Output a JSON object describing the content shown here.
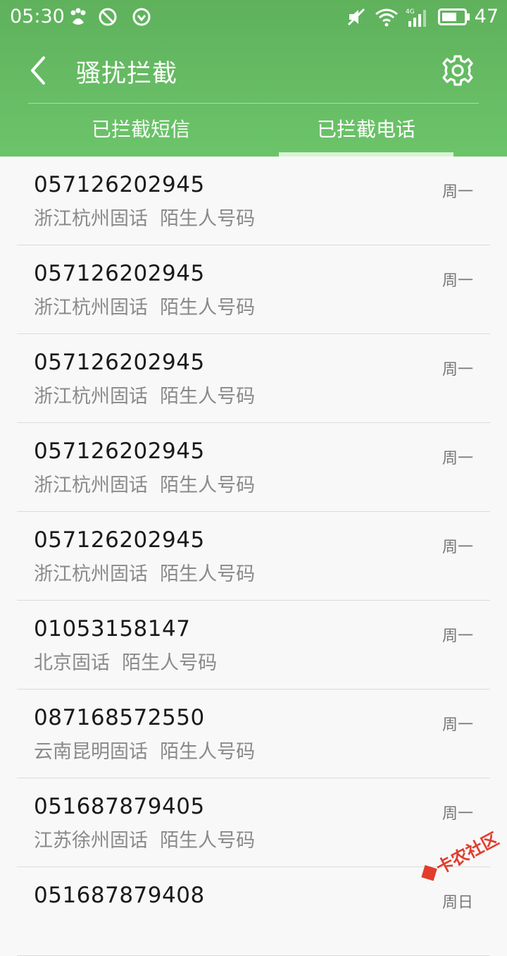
{
  "status_bar": {
    "time": "05:30",
    "battery": "47",
    "icons": [
      "baidu-paw-icon",
      "no-disturb-icon",
      "download-icon",
      "mute-icon",
      "wifi-icon",
      "signal-4g-icon",
      "battery-icon"
    ]
  },
  "toolbar": {
    "title": "骚扰拦截",
    "back_icon": "chevron-left-icon",
    "settings_icon": "gear-icon"
  },
  "tabs": [
    {
      "label": "已拦截短信",
      "active": false
    },
    {
      "label": "已拦截电话",
      "active": true
    }
  ],
  "calls": [
    {
      "number": "057126202945",
      "desc": "浙江杭州固话  陌生人号码",
      "day": "周一"
    },
    {
      "number": "057126202945",
      "desc": "浙江杭州固话  陌生人号码",
      "day": "周一"
    },
    {
      "number": "057126202945",
      "desc": "浙江杭州固话  陌生人号码",
      "day": "周一"
    },
    {
      "number": "057126202945",
      "desc": "浙江杭州固话  陌生人号码",
      "day": "周一"
    },
    {
      "number": "057126202945",
      "desc": "浙江杭州固话  陌生人号码",
      "day": "周一"
    },
    {
      "number": "01053158147",
      "desc": "北京固话  陌生人号码",
      "day": "周一"
    },
    {
      "number": "087168572550",
      "desc": "云南昆明固话  陌生人号码",
      "day": "周一"
    },
    {
      "number": "051687879405",
      "desc": "江苏徐州固话  陌生人号码",
      "day": "周一"
    },
    {
      "number": "051687879408",
      "desc": "",
      "day": "周日"
    }
  ],
  "watermark": "卡农社区",
  "colors": {
    "header": "#63b960",
    "text_primary": "#1a1a1a",
    "text_secondary": "#8a8a8a"
  }
}
